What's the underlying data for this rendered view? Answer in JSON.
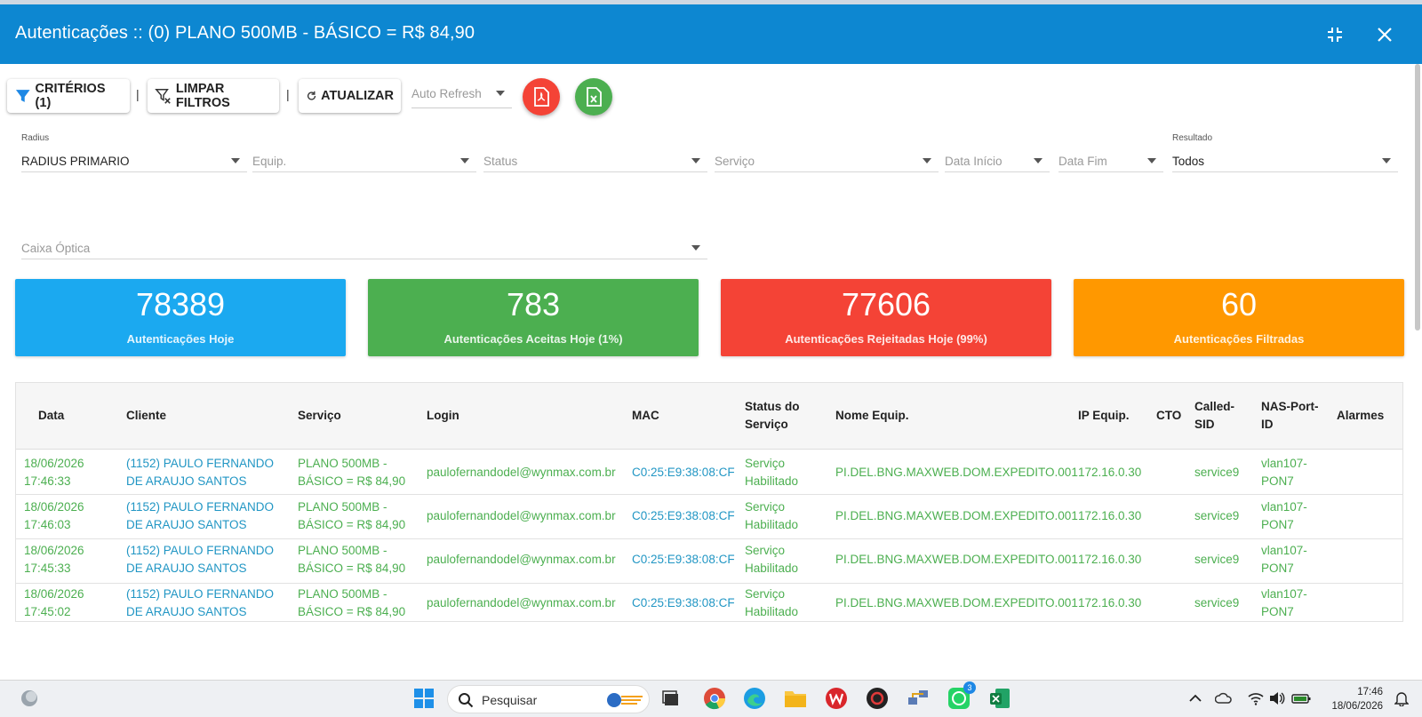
{
  "title": "Autenticações :: (0) PLANO 500MB - BÁSICO = R$ 84,90",
  "toolbar": {
    "criterios": "CRITÉRIOS (1)",
    "limpar": "LIMPAR FILTROS",
    "atualizar": "ATUALIZAR",
    "separator": "|",
    "auto_refresh_placeholder": "Auto Refresh"
  },
  "filters": {
    "radius": {
      "label": "Radius",
      "value": "RADIUS PRIMARIO"
    },
    "equip": {
      "placeholder": "Equip."
    },
    "status": {
      "placeholder": "Status"
    },
    "servico": {
      "placeholder": "Serviço"
    },
    "data_inicio": {
      "placeholder": "Data Início"
    },
    "data_fim": {
      "placeholder": "Data Fim"
    },
    "resultado": {
      "label": "Resultado",
      "value": "Todos"
    },
    "caixa_optica": {
      "placeholder": "Caixa Óptica"
    }
  },
  "cards": [
    {
      "value": "78389",
      "label": "Autenticações Hoje",
      "color": "#1ba9f0"
    },
    {
      "value": "783",
      "label": "Autenticações Aceitas Hoje (1%)",
      "color": "#4caf50"
    },
    {
      "value": "77606",
      "label": "Autenticações Rejeitadas Hoje (99%)",
      "color": "#f44336"
    },
    {
      "value": "60",
      "label": "Autenticações Filtradas",
      "color": "#ff9800"
    }
  ],
  "table": {
    "headers": {
      "data": "Data",
      "cliente": "Cliente",
      "servico": "Serviço",
      "login": "Login",
      "mac": "MAC",
      "status1": "Status do",
      "status2": "Serviço",
      "nome_equip": "Nome Equip.",
      "ip_equip": "IP Equip.",
      "cto": "CTO",
      "called1": "Called-",
      "called2": "SID",
      "nas1": "NAS-Port-",
      "nas2": "ID",
      "alarmes": "Alarmes"
    },
    "rows": [
      {
        "date": "18/06/2026",
        "time": "17:46:33",
        "cliente1": "(1152) PAULO FERNANDO",
        "cliente2": "DE ARAUJO SANTOS",
        "servico1": "PLANO 500MB -",
        "servico2": "BÁSICO = R$ 84,90",
        "login": "paulofernandodel@wynmax.com.br",
        "mac": "C0:25:E9:38:08:CF",
        "status1": "Serviço",
        "status2": "Habilitado",
        "nome_equip": "PI.DEL.BNG.MAXWEB.DOM.EXPEDITO.001",
        "ip": "172.16.0.30",
        "called": "service9",
        "nas1": "vlan107-",
        "nas2": "PON7"
      },
      {
        "date": "18/06/2026",
        "time": "17:46:03",
        "cliente1": "(1152) PAULO FERNANDO",
        "cliente2": "DE ARAUJO SANTOS",
        "servico1": "PLANO 500MB -",
        "servico2": "BÁSICO = R$ 84,90",
        "login": "paulofernandodel@wynmax.com.br",
        "mac": "C0:25:E9:38:08:CF",
        "status1": "Serviço",
        "status2": "Habilitado",
        "nome_equip": "PI.DEL.BNG.MAXWEB.DOM.EXPEDITO.001",
        "ip": "172.16.0.30",
        "called": "service9",
        "nas1": "vlan107-",
        "nas2": "PON7"
      },
      {
        "date": "18/06/2026",
        "time": "17:45:33",
        "cliente1": "(1152) PAULO FERNANDO",
        "cliente2": "DE ARAUJO SANTOS",
        "servico1": "PLANO 500MB -",
        "servico2": "BÁSICO = R$ 84,90",
        "login": "paulofernandodel@wynmax.com.br",
        "mac": "C0:25:E9:38:08:CF",
        "status1": "Serviço",
        "status2": "Habilitado",
        "nome_equip": "PI.DEL.BNG.MAXWEB.DOM.EXPEDITO.001",
        "ip": "172.16.0.30",
        "called": "service9",
        "nas1": "vlan107-",
        "nas2": "PON7"
      },
      {
        "date": "18/06/2026",
        "time": "17:45:02",
        "cliente1": "(1152) PAULO FERNANDO",
        "cliente2": "DE ARAUJO SANTOS",
        "servico1": "PLANO 500MB -",
        "servico2": "BÁSICO = R$ 84,90",
        "login": "paulofernandodel@wynmax.com.br",
        "mac": "C0:25:E9:38:08:CF",
        "status1": "Serviço",
        "status2": "Habilitado",
        "nome_equip": "PI.DEL.BNG.MAXWEB.DOM.EXPEDITO.001",
        "ip": "172.16.0.30",
        "called": "service9",
        "nas1": "vlan107-",
        "nas2": "PON7"
      }
    ]
  },
  "taskbar": {
    "search_placeholder": "Pesquisar",
    "whatsapp_badge": "3",
    "time": "17:46",
    "date": "18/06/2026",
    "icons": [
      "weather-icon",
      "windows-start-icon",
      "search-icon",
      "task-view-icon",
      "chrome-icon",
      "edge-icon",
      "file-explorer-icon",
      "wps-office-icon",
      "app-icon",
      "network-app-icon",
      "whatsapp-icon",
      "excel-icon"
    ]
  },
  "colors": {
    "titlebar": "#0d87d1",
    "link": "#2196c4",
    "success": "#4caf50",
    "pdf": "#f44336",
    "excel": "#4caf50"
  }
}
